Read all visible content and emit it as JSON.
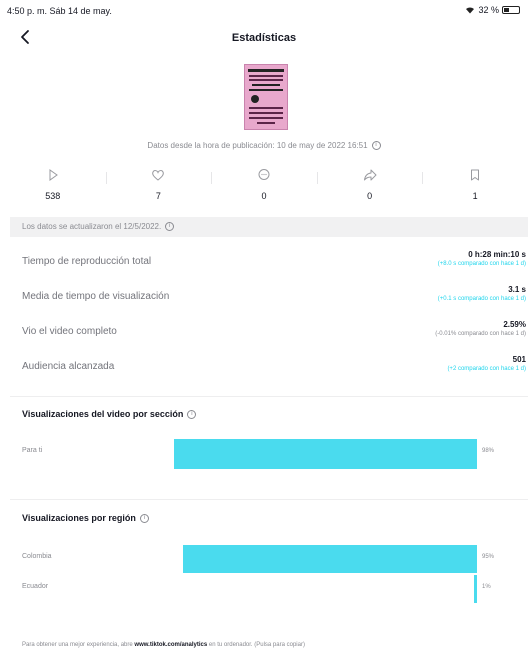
{
  "status_bar": {
    "time": "4:50 p. m.  Sáb 14 de may.",
    "battery": "32 %"
  },
  "nav": {
    "title": "Estadísticas"
  },
  "publication": {
    "text": "Datos desde la hora de publicación: 10 de may de 2022 16:51"
  },
  "metrics": [
    {
      "icon": "play-icon",
      "value": "538"
    },
    {
      "icon": "heart-icon",
      "value": "7"
    },
    {
      "icon": "comment-icon",
      "value": "0"
    },
    {
      "icon": "share-icon",
      "value": "0"
    },
    {
      "icon": "bookmark-icon",
      "value": "1"
    }
  ],
  "updated": "Los datos se actualizaron el 12/5/2022.",
  "stats": [
    {
      "label": "Tiempo de reproducción total",
      "value": "0 h:28 min:10 s",
      "delta": "(+8.0 s comparado con hace 1 d)"
    },
    {
      "label": "Media de tiempo de visualización",
      "value": "3.1 s",
      "delta": "(+0.1 s comparado con hace 1 d)"
    },
    {
      "label": "Vio el video completo",
      "value": "2.59%",
      "delta": "(-0.01% comparado con hace 1 d)"
    },
    {
      "label": "Audiencia alcanzada",
      "value": "501",
      "delta": "(+2 comparado con hace 1 d)"
    }
  ],
  "section_views": {
    "title": "Visualizaciones del video por sección",
    "rows": [
      {
        "label": "Para ti",
        "percent": 98,
        "percent_text": "98%"
      }
    ]
  },
  "section_regions": {
    "title": "Visualizaciones por región",
    "rows": [
      {
        "label": "Colombia",
        "percent": 95,
        "percent_text": "95%"
      },
      {
        "label": "Ecuador",
        "percent": 1,
        "percent_text": "1%"
      }
    ]
  },
  "footer": {
    "prefix": "Para obtener una mejor experiencia, abre ",
    "link": "www.tiktok.com/analytics",
    "suffix": " en tu ordenador. (Pulsa para copiar)"
  },
  "colors": {
    "bar": "#4adbee",
    "delta": "#20d5ec"
  }
}
